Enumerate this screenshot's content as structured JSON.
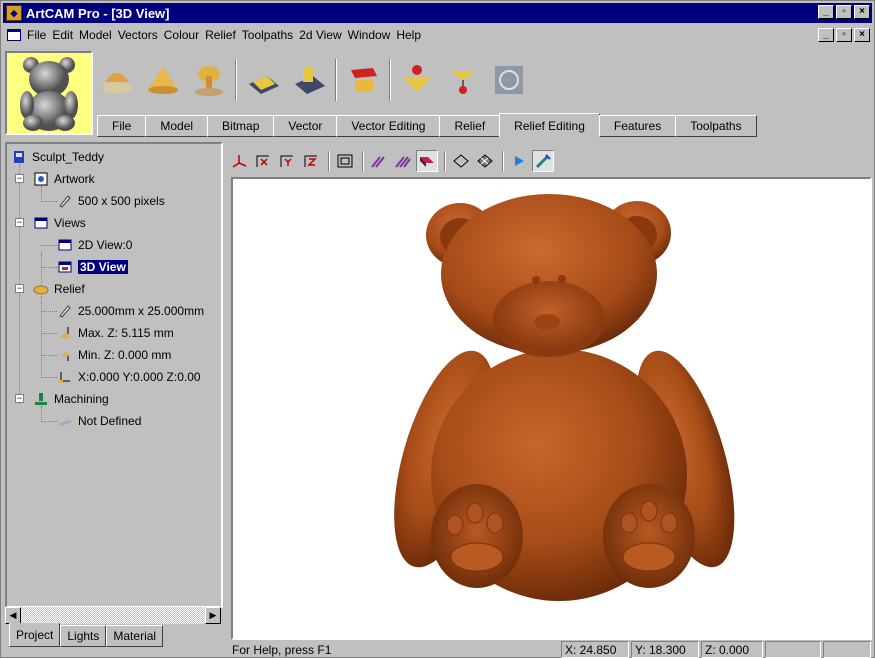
{
  "window": {
    "title": "ArtCAM Pro - [3D View]",
    "minimize": "_",
    "restore": "▫",
    "close": "×"
  },
  "menu": [
    "File",
    "Edit",
    "Model",
    "Vectors",
    "Colour",
    "Relief",
    "Toolpaths",
    "2d View",
    "Window",
    "Help"
  ],
  "menu_underline": [
    "F",
    "E",
    "M",
    "e",
    "C",
    "R",
    "T",
    "2",
    "W",
    "H"
  ],
  "toolbar": {
    "icons": [
      "relief-combine-icon",
      "relief-add-icon",
      "relief-mushroom-icon",
      "vector-plate-icon",
      "vector-offset-icon",
      "relief-extrude-icon",
      "relief-zero-icon",
      "relief-pin-icon",
      "relief-texture-icon"
    ]
  },
  "tabs": [
    "File",
    "Model",
    "Bitmap",
    "Vector",
    "Vector Editing",
    "Relief",
    "Relief Editing",
    "Features",
    "Toolpaths"
  ],
  "active_tab": "Relief Editing",
  "tree": {
    "project": "Sculpt_Teddy",
    "artwork": "Artwork",
    "artwork_size": "500 x 500 pixels",
    "views": "Views",
    "view_2d": "2D View:0",
    "view_3d": "3D View",
    "relief": "Relief",
    "relief_size": "25.000mm x 25.000mm",
    "max_z": "Max. Z: 5.115 mm",
    "min_z": "Min. Z: 0.000 mm",
    "origin": "X:0.000  Y:0.000  Z:0.00",
    "machining": "Machining",
    "not_defined": "Not Defined"
  },
  "bottom_tabs": [
    "Project",
    "Lights",
    "Material"
  ],
  "active_bottom_tab": "Project",
  "status": {
    "help": "For Help, press F1",
    "x": "X: 24.850",
    "y": "Y: 18.300",
    "z": "Z: 0.000"
  },
  "colors": {
    "title_bar": "#00007f",
    "model": "#a8501c",
    "selection": "#00007f"
  }
}
